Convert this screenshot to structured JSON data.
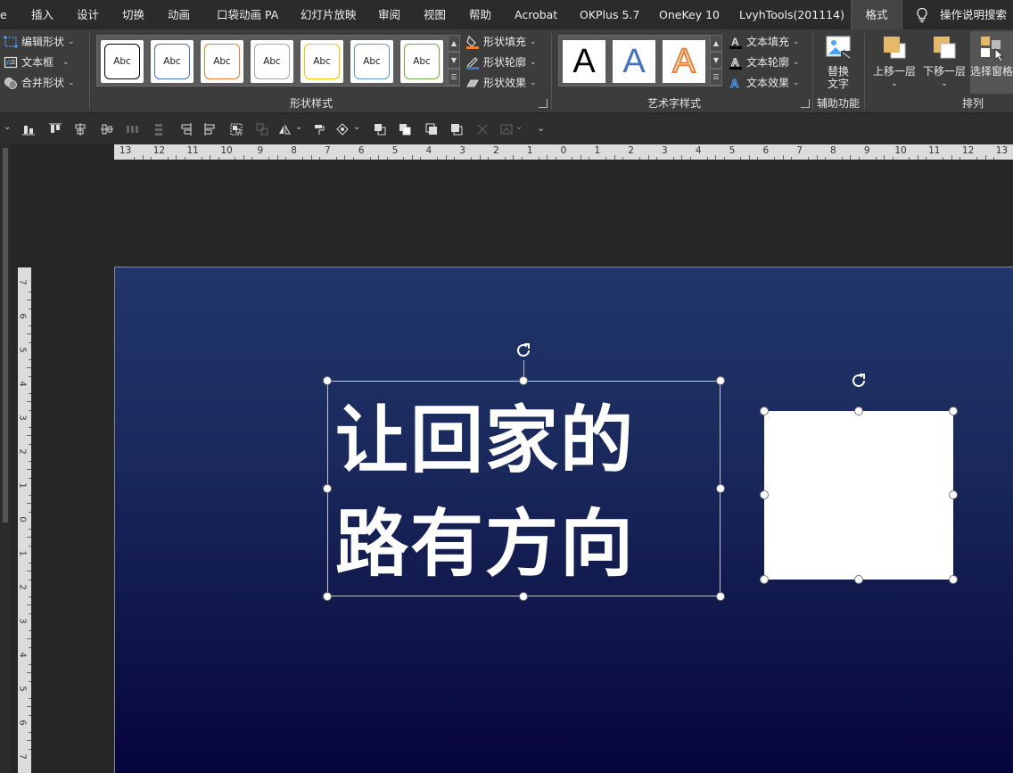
{
  "menu": {
    "tabs": [
      "e",
      "插入",
      "设计",
      "切换",
      "动画",
      "口袋动画 PA",
      "幻灯片放映",
      "审阅",
      "视图",
      "帮助",
      "Acrobat",
      "OKPlus 5.7",
      "OneKey 10",
      "LvyhTools(201114)",
      "格式"
    ],
    "active_tab": "格式",
    "search_label": "操作说明搜索"
  },
  "ribbon": {
    "insert_shapes": {
      "edit_shape": "编辑形状",
      "text_box": "文本框",
      "merge_shapes": "合并形状"
    },
    "shape_styles": {
      "group_label": "形状样式",
      "thumb_text": "Abc",
      "thumb_colors": [
        "#000000",
        "#4472c4",
        "#ed7d31",
        "#a5a5a5",
        "#ffc000",
        "#5b9bd5",
        "#70ad47"
      ],
      "shape_fill": "形状填充",
      "shape_outline": "形状轮廓",
      "shape_effects": "形状效果"
    },
    "wordart_styles": {
      "group_label": "艺术字样式",
      "sample": "A",
      "sample_colors": [
        "#000000",
        "#4472c4",
        "#ed7d31"
      ],
      "text_fill": "文本填充",
      "text_outline": "文本轮廓",
      "text_effects": "文本效果"
    },
    "accessibility": {
      "group_label": "辅助功能",
      "alt_text_line1": "替换",
      "alt_text_line2": "文字"
    },
    "arrange": {
      "group_label": "排列",
      "bring_forward": "上移一层",
      "send_backward": "下移一层",
      "selection_pane": "选择窗格"
    }
  },
  "ruler": {
    "horizontal": [
      "13",
      "12",
      "11",
      "10",
      "9",
      "8",
      "7",
      "6",
      "5",
      "4",
      "3",
      "2",
      "1",
      "0",
      "1",
      "2",
      "3",
      "4",
      "5",
      "6",
      "7",
      "8",
      "9",
      "10",
      "11",
      "12",
      "13"
    ],
    "vertical": [
      "7",
      "6",
      "5",
      "4",
      "3",
      "2",
      "1",
      "0",
      "1",
      "2",
      "3",
      "4",
      "5",
      "6",
      "7"
    ]
  },
  "slide": {
    "headline_line1": "让回家的",
    "headline_line2": "路有方向"
  }
}
